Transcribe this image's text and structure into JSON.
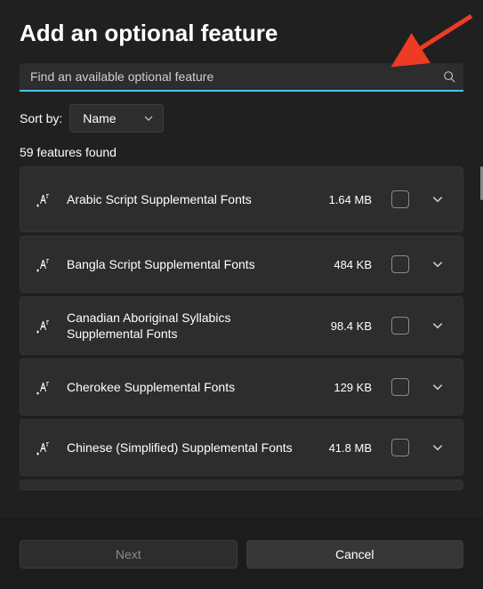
{
  "title": "Add an optional feature",
  "search": {
    "placeholder": "Find an available optional feature",
    "value": ""
  },
  "sort": {
    "label": "Sort by:",
    "selected": "Name"
  },
  "results_count": "59 features found",
  "features": [
    {
      "name": "Arabic Script Supplemental Fonts",
      "size": "1.64 MB"
    },
    {
      "name": "Bangla Script Supplemental Fonts",
      "size": "484 KB"
    },
    {
      "name": "Canadian Aboriginal Syllabics Supplemental Fonts",
      "size": "98.4 KB"
    },
    {
      "name": "Cherokee Supplemental Fonts",
      "size": "129 KB"
    },
    {
      "name": "Chinese (Simplified) Supplemental Fonts",
      "size": "41.8 MB"
    }
  ],
  "buttons": {
    "next": "Next",
    "cancel": "Cancel"
  },
  "colors": {
    "accent": "#4cc2ff",
    "surface": "#2d2d2d",
    "bg": "#202020",
    "arrow": "#ed3b26"
  }
}
